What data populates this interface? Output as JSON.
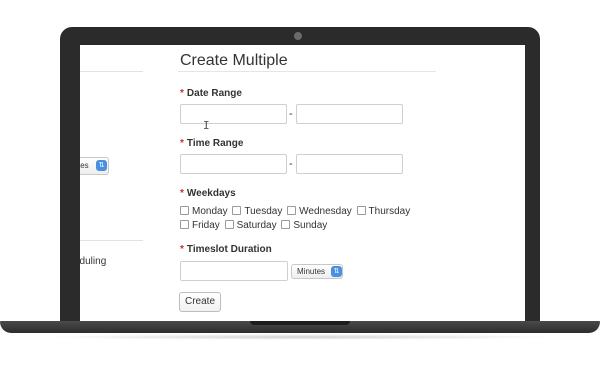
{
  "sidebar": {
    "select_text": "tes",
    "link_text": "eduling"
  },
  "form": {
    "title": "Create Multiple",
    "required_marker": "*",
    "date_range": {
      "label": "Date Range",
      "separator": "-",
      "start_value": "",
      "end_value": ""
    },
    "time_range": {
      "label": "Time Range",
      "separator": "-",
      "start_value": "",
      "end_value": ""
    },
    "weekdays": {
      "label": "Weekdays",
      "days": [
        "Monday",
        "Tuesday",
        "Wednesday",
        "Thursday",
        "Friday",
        "Saturday",
        "Sunday"
      ]
    },
    "timeslot_duration": {
      "label": "Timeslot Duration",
      "value": "",
      "unit": "Minutes"
    },
    "submit_label": "Create"
  },
  "icons": {
    "text_cursor": "text-cursor-icon",
    "select_arrows": "updown-arrows-icon"
  },
  "colors": {
    "required": "#c9302c",
    "select_accent": "#4a90e2",
    "laptop_frame": "#2b2b2b"
  }
}
